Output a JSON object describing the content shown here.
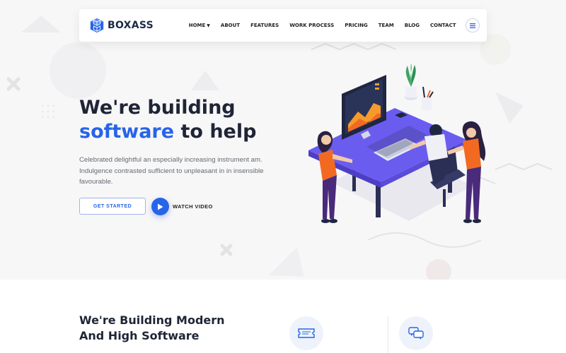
{
  "brand": {
    "name": "BOXASS"
  },
  "nav": {
    "items": [
      {
        "label": "HOME",
        "has_dropdown": true
      },
      {
        "label": "ABOUT"
      },
      {
        "label": "FEATURES"
      },
      {
        "label": "WORK PROCESS"
      },
      {
        "label": "PRICING"
      },
      {
        "label": "TEAM"
      },
      {
        "label": "BLOG"
      },
      {
        "label": "CONTACT"
      }
    ],
    "menu_icon": "hamburger-icon"
  },
  "hero": {
    "headline_line1": "We're building",
    "headline_accent": "software",
    "headline_rest": " to help",
    "description": "Celebrated delightful an especially increasing instrument am. Indulgence contrasted sufficient to unpleasant in in insensible favourable.",
    "primary_button": "GET STARTED",
    "video_label": "WATCH VIDEO"
  },
  "section": {
    "title_line1": "We're Building Modern",
    "title_line2": "And High Software",
    "features": [
      {
        "icon": "ticket-icon"
      },
      {
        "icon": "chat-bubbles-icon"
      }
    ]
  },
  "colors": {
    "accent": "#2764e8",
    "heading": "#1f2536",
    "desk": "#6b5cf0",
    "figure_shirt": "#f26a21",
    "figure_pants": "#4a2a7a"
  }
}
